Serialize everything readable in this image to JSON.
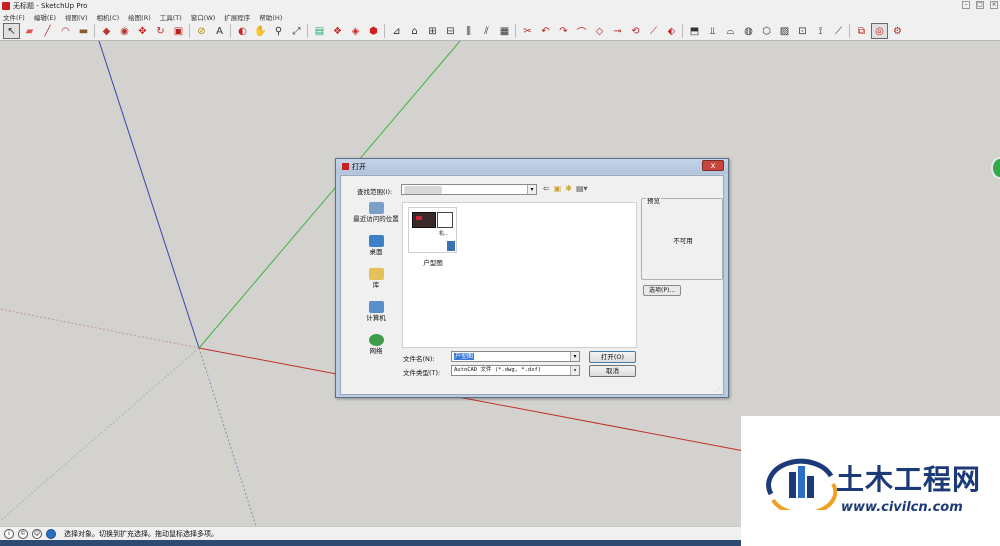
{
  "app": {
    "title": "无标题 - SketchUp Pro"
  },
  "menu": [
    "文件(F)",
    "编辑(E)",
    "视图(V)",
    "相机(C)",
    "绘图(R)",
    "工具(T)",
    "窗口(W)",
    "扩展程序",
    "帮助(H)"
  ],
  "toolbar": {
    "icons": [
      "select-arrow",
      "eraser",
      "pencil-line",
      "arc",
      "rectangle",
      "push-pull",
      "follow-me",
      "move",
      "rotate",
      "scale",
      "tape-measure",
      "text",
      "orbit",
      "pan",
      "zoom",
      "zoom-extents",
      "section-plane",
      "components",
      "materials",
      "warehouse",
      "extensions-a",
      "extensions-b",
      "extensions-c",
      "extensions-d",
      "extensions-e",
      "extensions-f",
      "extensions-g",
      "extensions-h",
      "extensions-i",
      "extensions-j",
      "extensions-k",
      "extensions-l",
      "extensions-m",
      "extensions-n",
      "extensions-o",
      "extensions-p",
      "extensions-q",
      "extensions-r",
      "extensions-s",
      "extensions-t",
      "extensions-u",
      "extensions-v",
      "extensions-w",
      "extensions-x",
      "extensions-y",
      "ruby-console",
      "settings"
    ]
  },
  "dialog": {
    "title": "打开",
    "close_label": "x",
    "look_in_label": "查找范围(I):",
    "places": [
      {
        "label": "最近访问的位置",
        "icon": "recent-places-icon",
        "color": "#7aa0c8"
      },
      {
        "label": "桌面",
        "icon": "desktop-icon",
        "color": "#3d7fc9"
      },
      {
        "label": "库",
        "icon": "library-icon",
        "color": "#e5c15a"
      },
      {
        "label": "计算机",
        "icon": "computer-icon",
        "color": "#5a8fc9"
      },
      {
        "label": "网络",
        "icon": "network-icon",
        "color": "#3f9a4a"
      }
    ],
    "file": {
      "thumb_label": "机...",
      "name": "户型图"
    },
    "preview_label": "预览",
    "preview_text": "不可用",
    "options_label": "选项(P)...",
    "filename_label": "文件名(N):",
    "filename_value": "户型图",
    "filetype_label": "文件类型(T):",
    "filetype_value": "AutoCAD 文件 (*.dwg, *.dxf)",
    "open_label": "打开(O)",
    "cancel_label": "取消"
  },
  "status": {
    "text": "选择对象。切换到扩充选择。拖动鼠标选择多项。"
  },
  "watermark": {
    "title": "土木工程网",
    "url": "www.civilcn.com",
    "color": "#1c3a78"
  },
  "colors": {
    "axis_blue": "#3a46a8",
    "axis_green": "#3fb33f",
    "axis_red": "#c0302a",
    "canvas": "#d3d2ce"
  }
}
